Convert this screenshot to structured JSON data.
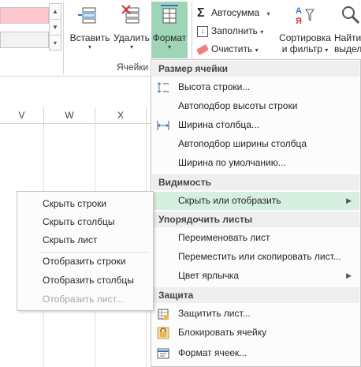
{
  "ribbon": {
    "insert_label": "Вставить",
    "delete_label": "Удалить",
    "format_label": "Формат",
    "cells_group_label": "Ячейки",
    "autosum_label": "Автосумма",
    "fill_label": "Заполнить",
    "clear_label": "Очистить",
    "sort_label_1": "Сортировка",
    "sort_label_2": "и фильтр",
    "find_label_1": "Найти",
    "find_label_2": "выдел",
    "accent_color": "#9fd5b7",
    "pink_style_color": "#ffc7ce"
  },
  "columns": [
    "V",
    "W",
    "X"
  ],
  "format_menu": {
    "section_cell_size": "Размер ячейки",
    "row_height": "Высота строки...",
    "autofit_row_height": "Автоподбор высоты строки",
    "column_width": "Ширина столбца...",
    "autofit_column_width": "Автоподбор ширины столбца",
    "default_width": "Ширина по умолчанию...",
    "section_visibility": "Видимость",
    "hide_unhide": "Скрыть или отобразить",
    "section_organize": "Упорядочить листы",
    "rename_sheet": "Переименовать лист",
    "move_copy_sheet": "Переместить или скопировать лист...",
    "tab_color": "Цвет ярлычка",
    "section_protection": "Защита",
    "protect_sheet": "Защитить лист...",
    "lock_cell": "Блокировать ячейку",
    "format_cells": "Формат ячеек..."
  },
  "hide_submenu": {
    "hide_rows": "Скрыть строки",
    "hide_columns": "Скрыть столбцы",
    "hide_sheet": "Скрыть лист",
    "unhide_rows": "Отобразить строки",
    "unhide_columns": "Отобразить столбцы",
    "unhide_sheet": "Отобразить лист..."
  }
}
